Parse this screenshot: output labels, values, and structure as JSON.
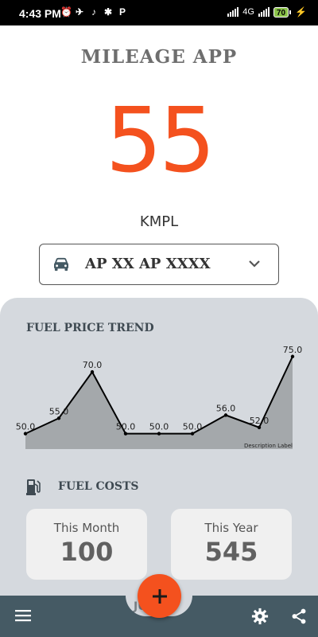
{
  "status_bar": {
    "time": "4:43 PM",
    "apps": [
      "⏰",
      "✈",
      "♪",
      "✱",
      "P"
    ],
    "network": "4G",
    "battery": "70"
  },
  "app": {
    "title": "MILEAGE APP",
    "mileage_value": "55",
    "mileage_unit": "KMPL",
    "accent_color": "#f4511e"
  },
  "vehicle_select": {
    "selected": "AP XX AP XXXX",
    "icon": "car-icon"
  },
  "fuel_price_trend": {
    "title": "FUEL PRICE TREND",
    "description_label": "Description Label"
  },
  "chart_data": {
    "type": "area",
    "title": "FUEL PRICE TREND",
    "x": [
      0,
      1,
      2,
      3,
      4,
      5,
      6,
      7,
      8
    ],
    "values": [
      50.0,
      55.0,
      70.0,
      50.0,
      50.0,
      50.0,
      56.0,
      52.0,
      75.0
    ],
    "value_labels": [
      "50.0",
      "55.0",
      "70.0",
      "50.0",
      "50.0",
      "50.0",
      "56.0",
      "52.0",
      "75.0"
    ],
    "ylim": [
      45,
      77
    ],
    "grid": false,
    "legend": "none",
    "fill_color": "#a4a8ab",
    "line_color": "#000000"
  },
  "fuel_costs": {
    "title": "FUEL COSTS",
    "icon": "fuel-pump-icon",
    "this_month_label": "This Month",
    "this_month_value": "100",
    "this_year_label": "This Year",
    "this_year_value": "545"
  },
  "bottom_bar": {
    "menu_icon": "menu-icon",
    "settings_icon": "gear-icon",
    "share_icon": "share-icon",
    "fab_icon": "plus-icon",
    "hidden_label": "JUST"
  }
}
